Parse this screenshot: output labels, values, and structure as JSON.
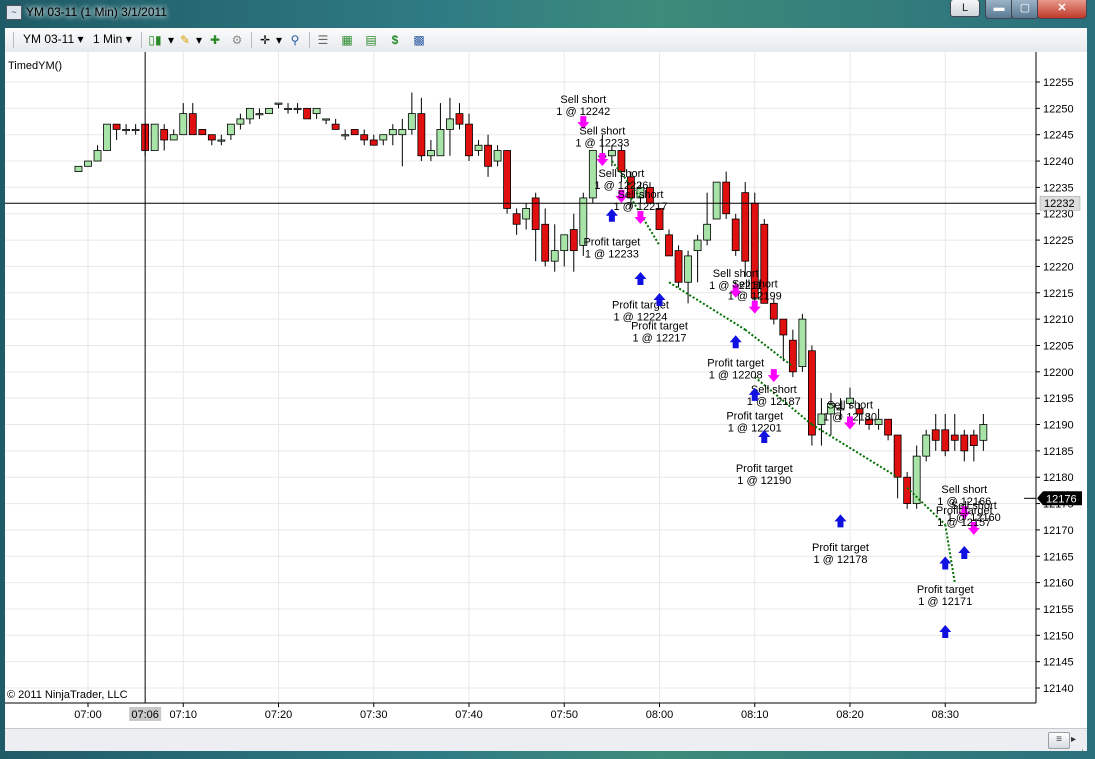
{
  "window": {
    "title": "YM 03-11 (1 Min)  3/1/2011",
    "caption_buttons": {
      "layout": "L",
      "minimize": "▬",
      "maximize": "▢",
      "close": "✕"
    }
  },
  "toolbar": {
    "instrument": "YM 03-11",
    "interval": "1 Min",
    "icons": [
      "candlestick-style-icon",
      "pencil-draw-icon",
      "insert-indicator-icon",
      "strategy-icon",
      "crosshair-icon",
      "zoom-icon",
      "properties-icon",
      "chart-trader-icon",
      "data-box-icon",
      "dollar-order-icon",
      "window-layout-icon"
    ]
  },
  "chart": {
    "indicator_label": "TimedYM()",
    "copyright": "© 2011 NinjaTrader, LLC",
    "current_price": "12176",
    "crosshair_price": "12232",
    "crosshair_time": "07:06",
    "colors": {
      "up_candle": "#a8e3a8",
      "down_candle": "#e01010",
      "sell_arrow": "#ff00ff",
      "buy_arrow": "#1010e0",
      "trade_line": "#007000"
    }
  },
  "chart_data": {
    "type": "candlestick",
    "title": "",
    "xlabel": "",
    "ylabel": "",
    "x_ticks": [
      "07:00",
      "07:10",
      "07:20",
      "07:30",
      "07:40",
      "07:50",
      "08:00",
      "08:10",
      "08:20",
      "08:30"
    ],
    "x_range": [
      "06:58",
      "08:35"
    ],
    "y_ticks": [
      12140,
      12145,
      12150,
      12155,
      12160,
      12165,
      12170,
      12175,
      12180,
      12185,
      12190,
      12195,
      12200,
      12205,
      12210,
      12215,
      12220,
      12225,
      12230,
      12235,
      12240,
      12245,
      12250,
      12255
    ],
    "ylim": [
      12137,
      12258
    ],
    "candles": [
      {
        "t": "06:59",
        "o": 12238,
        "h": 12239,
        "l": 12238,
        "c": 12239
      },
      {
        "t": "07:00",
        "o": 12239,
        "h": 12240,
        "l": 12239,
        "c": 12240
      },
      {
        "t": "07:01",
        "o": 12240,
        "h": 12243,
        "l": 12240,
        "c": 12242
      },
      {
        "t": "07:02",
        "o": 12242,
        "h": 12247,
        "l": 12242,
        "c": 12247
      },
      {
        "t": "07:03",
        "o": 12247,
        "h": 12247,
        "l": 12244,
        "c": 12246
      },
      {
        "t": "07:04",
        "o": 12246,
        "h": 12247,
        "l": 12245,
        "c": 12246
      },
      {
        "t": "07:05",
        "o": 12246,
        "h": 12247,
        "l": 12245,
        "c": 12246
      },
      {
        "t": "07:06",
        "o": 12247,
        "h": 12247,
        "l": 12241,
        "c": 12242
      },
      {
        "t": "07:07",
        "o": 12242,
        "h": 12247,
        "l": 12242,
        "c": 12247
      },
      {
        "t": "07:08",
        "o": 12246,
        "h": 12247,
        "l": 12242,
        "c": 12244
      },
      {
        "t": "07:09",
        "o": 12244,
        "h": 12246,
        "l": 12244,
        "c": 12245
      },
      {
        "t": "07:10",
        "o": 12245,
        "h": 12251,
        "l": 12245,
        "c": 12249
      },
      {
        "t": "07:11",
        "o": 12249,
        "h": 12251,
        "l": 12245,
        "c": 12245
      },
      {
        "t": "07:12",
        "o": 12246,
        "h": 12246,
        "l": 12245,
        "c": 12245
      },
      {
        "t": "07:13",
        "o": 12245,
        "h": 12245,
        "l": 12243,
        "c": 12244
      },
      {
        "t": "07:14",
        "o": 12244,
        "h": 12245,
        "l": 12243,
        "c": 12244
      },
      {
        "t": "07:15",
        "o": 12245,
        "h": 12247,
        "l": 12244,
        "c": 12247
      },
      {
        "t": "07:16",
        "o": 12247,
        "h": 12249,
        "l": 12246,
        "c": 12248
      },
      {
        "t": "07:17",
        "o": 12248,
        "h": 12250,
        "l": 12247,
        "c": 12250
      },
      {
        "t": "07:18",
        "o": 12249,
        "h": 12250,
        "l": 12248,
        "c": 12249
      },
      {
        "t": "07:19",
        "o": 12249,
        "h": 12250,
        "l": 12249,
        "c": 12250
      },
      {
        "t": "07:20",
        "o": 12251,
        "h": 12251,
        "l": 12250,
        "c": 12251
      },
      {
        "t": "07:21",
        "o": 12250,
        "h": 12251,
        "l": 12249,
        "c": 12250
      },
      {
        "t": "07:22",
        "o": 12250,
        "h": 12251,
        "l": 12249,
        "c": 12250
      },
      {
        "t": "07:23",
        "o": 12250,
        "h": 12250,
        "l": 12248,
        "c": 12248
      },
      {
        "t": "07:24",
        "o": 12249,
        "h": 12250,
        "l": 12248,
        "c": 12250
      },
      {
        "t": "07:25",
        "o": 12248,
        "h": 12248,
        "l": 12247,
        "c": 12248
      },
      {
        "t": "07:26",
        "o": 12247,
        "h": 12248,
        "l": 12246,
        "c": 12246
      },
      {
        "t": "07:27",
        "o": 12245,
        "h": 12246,
        "l": 12244,
        "c": 12245
      },
      {
        "t": "07:28",
        "o": 12246,
        "h": 12246,
        "l": 12245,
        "c": 12245
      },
      {
        "t": "07:29",
        "o": 12245,
        "h": 12246,
        "l": 12243,
        "c": 12244
      },
      {
        "t": "07:30",
        "o": 12244,
        "h": 12245,
        "l": 12243,
        "c": 12243
      },
      {
        "t": "07:31",
        "o": 12244,
        "h": 12245,
        "l": 12243,
        "c": 12245
      },
      {
        "t": "07:32",
        "o": 12245,
        "h": 12247,
        "l": 12243,
        "c": 12246
      },
      {
        "t": "07:33",
        "o": 12245,
        "h": 12248,
        "l": 12239,
        "c": 12246
      },
      {
        "t": "07:34",
        "o": 12246,
        "h": 12253,
        "l": 12245,
        "c": 12249
      },
      {
        "t": "07:35",
        "o": 12249,
        "h": 12252,
        "l": 12240,
        "c": 12241
      },
      {
        "t": "07:36",
        "o": 12241,
        "h": 12244,
        "l": 12240,
        "c": 12242
      },
      {
        "t": "07:37",
        "o": 12241,
        "h": 12251,
        "l": 12241,
        "c": 12246
      },
      {
        "t": "07:38",
        "o": 12246,
        "h": 12252,
        "l": 12241,
        "c": 12248
      },
      {
        "t": "07:39",
        "o": 12249,
        "h": 12251,
        "l": 12246,
        "c": 12247
      },
      {
        "t": "07:40",
        "o": 12247,
        "h": 12249,
        "l": 12240,
        "c": 12241
      },
      {
        "t": "07:41",
        "o": 12242,
        "h": 12244,
        "l": 12241,
        "c": 12243
      },
      {
        "t": "07:42",
        "o": 12243,
        "h": 12245,
        "l": 12237,
        "c": 12239
      },
      {
        "t": "07:43",
        "o": 12240,
        "h": 12243,
        "l": 12239,
        "c": 12242
      },
      {
        "t": "07:44",
        "o": 12242,
        "h": 12242,
        "l": 12230,
        "c": 12231
      },
      {
        "t": "07:45",
        "o": 12230,
        "h": 12231,
        "l": 12226,
        "c": 12228
      },
      {
        "t": "07:46",
        "o": 12229,
        "h": 12232,
        "l": 12227,
        "c": 12231
      },
      {
        "t": "07:47",
        "o": 12233,
        "h": 12234,
        "l": 12221,
        "c": 12227
      },
      {
        "t": "07:48",
        "o": 12228,
        "h": 12231,
        "l": 12220,
        "c": 12221
      },
      {
        "t": "07:49",
        "o": 12221,
        "h": 12228,
        "l": 12219,
        "c": 12223
      },
      {
        "t": "07:50",
        "o": 12223,
        "h": 12226,
        "l": 12220,
        "c": 12226
      },
      {
        "t": "07:51",
        "o": 12227,
        "h": 12230,
        "l": 12219,
        "c": 12223
      },
      {
        "t": "07:52",
        "o": 12224,
        "h": 12234,
        "l": 12222,
        "c": 12233
      },
      {
        "t": "07:53",
        "o": 12233,
        "h": 12241,
        "l": 12232,
        "c": 12242
      },
      {
        "t": "07:54",
        "o": 12241,
        "h": 12245,
        "l": 12240,
        "c": 12241
      },
      {
        "t": "07:55",
        "o": 12241,
        "h": 12243,
        "l": 12239,
        "c": 12242
      },
      {
        "t": "07:56",
        "o": 12242,
        "h": 12243,
        "l": 12236,
        "c": 12238
      },
      {
        "t": "07:57",
        "o": 12237,
        "h": 12238,
        "l": 12231,
        "c": 12233
      },
      {
        "t": "07:58",
        "o": 12233,
        "h": 12236,
        "l": 12232,
        "c": 12235
      },
      {
        "t": "07:59",
        "o": 12235,
        "h": 12236,
        "l": 12232,
        "c": 12232
      },
      {
        "t": "08:00",
        "o": 12231,
        "h": 12231,
        "l": 12227,
        "c": 12227
      },
      {
        "t": "08:01",
        "o": 12226,
        "h": 12227,
        "l": 12222,
        "c": 12222
      },
      {
        "t": "08:02",
        "o": 12223,
        "h": 12224,
        "l": 12216,
        "c": 12217
      },
      {
        "t": "08:03",
        "o": 12217,
        "h": 12223,
        "l": 12213,
        "c": 12222
      },
      {
        "t": "08:04",
        "o": 12223,
        "h": 12226,
        "l": 12217,
        "c": 12225
      },
      {
        "t": "08:05",
        "o": 12225,
        "h": 12234,
        "l": 12224,
        "c": 12228
      },
      {
        "t": "08:06",
        "o": 12229,
        "h": 12236,
        "l": 12229,
        "c": 12236
      },
      {
        "t": "08:07",
        "o": 12236,
        "h": 12238,
        "l": 12229,
        "c": 12230
      },
      {
        "t": "08:08",
        "o": 12229,
        "h": 12230,
        "l": 12222,
        "c": 12223
      },
      {
        "t": "08:09",
        "o": 12234,
        "h": 12236,
        "l": 12218,
        "c": 12221
      },
      {
        "t": "08:10",
        "o": 12232,
        "h": 12234,
        "l": 12213,
        "c": 12214
      },
      {
        "t": "08:11",
        "o": 12228,
        "h": 12229,
        "l": 12213,
        "c": 12213
      },
      {
        "t": "08:12",
        "o": 12213,
        "h": 12214,
        "l": 12209,
        "c": 12210
      },
      {
        "t": "08:13",
        "o": 12210,
        "h": 12210,
        "l": 12202,
        "c": 12207
      },
      {
        "t": "08:14",
        "o": 12206,
        "h": 12208,
        "l": 12199,
        "c": 12200
      },
      {
        "t": "08:15",
        "o": 12201,
        "h": 12211,
        "l": 12200,
        "c": 12210
      },
      {
        "t": "08:16",
        "o": 12204,
        "h": 12205,
        "l": 12186,
        "c": 12188
      },
      {
        "t": "08:17",
        "o": 12190,
        "h": 12195,
        "l": 12186,
        "c": 12192
      },
      {
        "t": "08:18",
        "o": 12192,
        "h": 12196,
        "l": 12188,
        "c": 12194
      },
      {
        "t": "08:19",
        "o": 12193,
        "h": 12195,
        "l": 12191,
        "c": 12193
      },
      {
        "t": "08:20",
        "o": 12194,
        "h": 12197,
        "l": 12193,
        "c": 12195
      },
      {
        "t": "08:21",
        "o": 12193,
        "h": 12194,
        "l": 12190,
        "c": 12192
      },
      {
        "t": "08:22",
        "o": 12191,
        "h": 12192,
        "l": 12189,
        "c": 12190
      },
      {
        "t": "08:23",
        "o": 12190,
        "h": 12193,
        "l": 12189,
        "c": 12191
      },
      {
        "t": "08:24",
        "o": 12191,
        "h": 12191,
        "l": 12187,
        "c": 12188
      },
      {
        "t": "08:25",
        "o": 12188,
        "h": 12188,
        "l": 12176,
        "c": 12180
      },
      {
        "t": "08:26",
        "o": 12180,
        "h": 12181,
        "l": 12174,
        "c": 12175
      },
      {
        "t": "08:27",
        "o": 12175,
        "h": 12186,
        "l": 12174,
        "c": 12184
      },
      {
        "t": "08:28",
        "o": 12184,
        "h": 12189,
        "l": 12183,
        "c": 12188
      },
      {
        "t": "08:29",
        "o": 12189,
        "h": 12192,
        "l": 12185,
        "c": 12187
      },
      {
        "t": "08:30",
        "o": 12189,
        "h": 12192,
        "l": 12184,
        "c": 12185
      },
      {
        "t": "08:31",
        "o": 12188,
        "h": 12192,
        "l": 12185,
        "c": 12187
      },
      {
        "t": "08:32",
        "o": 12188,
        "h": 12189,
        "l": 12183,
        "c": 12185
      },
      {
        "t": "08:33",
        "o": 12188,
        "h": 12189,
        "l": 12183,
        "c": 12186
      },
      {
        "t": "08:34",
        "o": 12187,
        "h": 12192,
        "l": 12185,
        "c": 12190
      }
    ],
    "annotations": [
      {
        "kind": "sell",
        "label": "Sell short",
        "qty": "1 @ 12242"
      },
      {
        "kind": "sell",
        "label": "Sell short",
        "qty": "1 @ 12233"
      },
      {
        "kind": "sell",
        "label": "Sell short",
        "qty": "1 @ 12226"
      },
      {
        "kind": "sell",
        "label": "Sell short",
        "qty": "1 @ 12217"
      },
      {
        "kind": "buy",
        "label": "Profit target",
        "qty": "1 @ 12233"
      },
      {
        "kind": "buy",
        "label": "Profit target",
        "qty": "1 @ 12224"
      },
      {
        "kind": "buy",
        "label": "Profit target",
        "qty": "1 @ 12217"
      },
      {
        "kind": "sell",
        "label": "Sell short",
        "qty": "1 @ 12211"
      },
      {
        "kind": "sell",
        "label": "Sell short",
        "qty": "1 @ 12199"
      },
      {
        "kind": "buy",
        "label": "Profit target",
        "qty": "1 @ 12208"
      },
      {
        "kind": "sell",
        "label": "Sell short",
        "qty": "1 @ 12187"
      },
      {
        "kind": "buy",
        "label": "Profit target",
        "qty": "1 @ 12201"
      },
      {
        "kind": "buy",
        "label": "Profit target",
        "qty": "1 @ 12190"
      },
      {
        "kind": "sell",
        "label": "Sell short",
        "qty": "1 @ 12180"
      },
      {
        "kind": "buy",
        "label": "Profit target",
        "qty": "1 @ 12178"
      },
      {
        "kind": "sell",
        "label": "Sell short",
        "qty": "1 @ 12166"
      },
      {
        "kind": "sell",
        "label": "Sell short",
        "qty": "1 @ 12160"
      },
      {
        "kind": "buy",
        "label": "Profit target",
        "qty": "1 @ 12157"
      },
      {
        "kind": "buy",
        "label": "Profit target",
        "qty": "1 @ 12171"
      }
    ]
  }
}
